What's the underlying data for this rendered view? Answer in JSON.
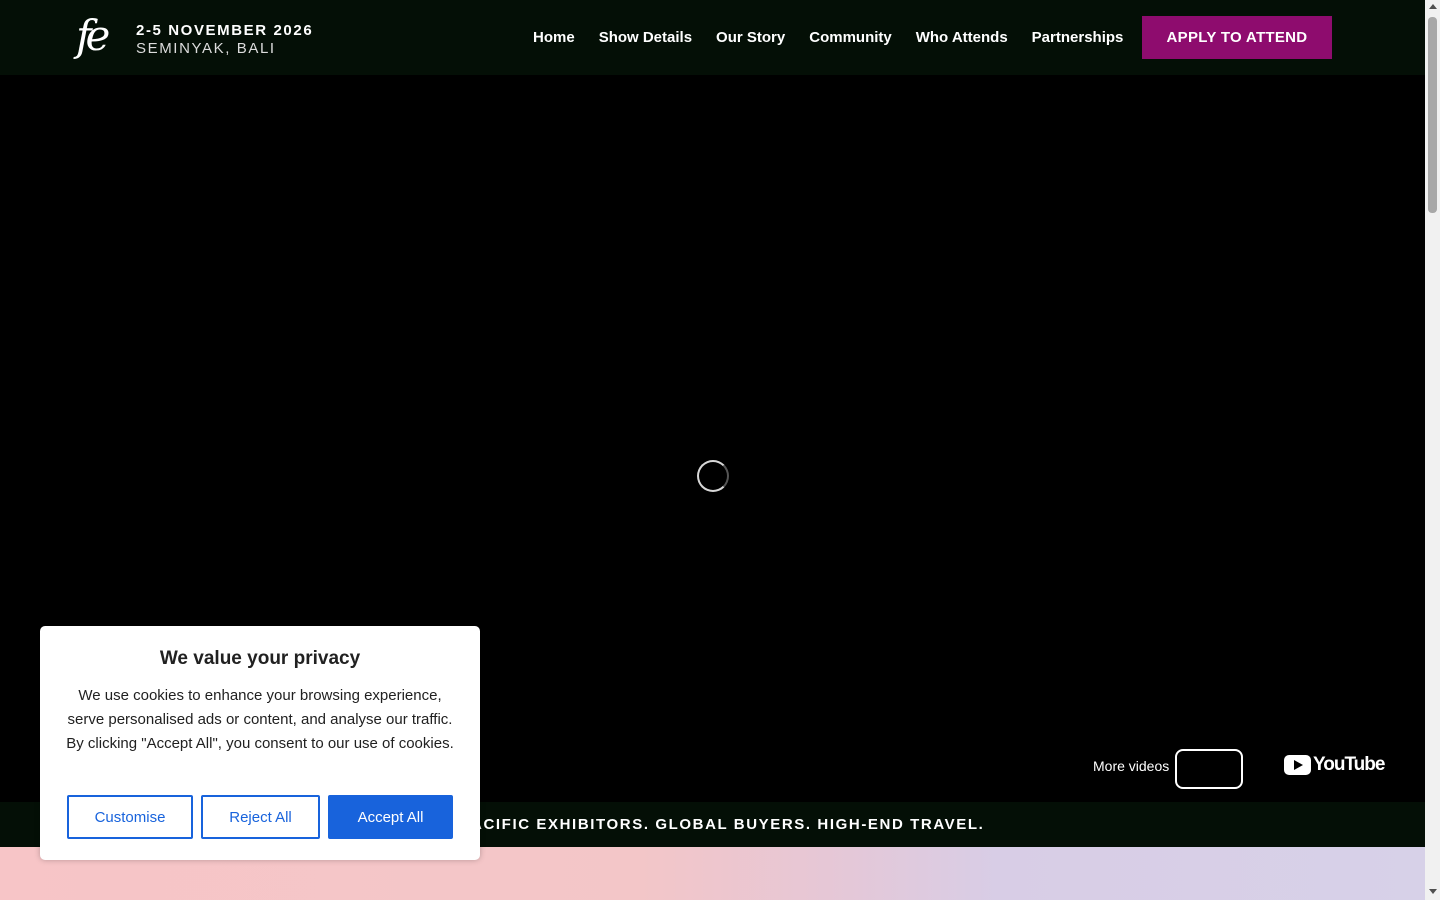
{
  "header": {
    "logo_text": "fe",
    "event_date": "2-5 NOVEMBER 2026",
    "event_location": "SEMINYAK, BALI",
    "nav": [
      {
        "label": "Home"
      },
      {
        "label": "Show Details"
      },
      {
        "label": "Our Story"
      },
      {
        "label": "Community"
      },
      {
        "label": "Who Attends"
      },
      {
        "label": "Partnerships"
      }
    ],
    "cta_label": "APPLY TO ATTEND",
    "cta_color": "#8e0c6e"
  },
  "video": {
    "more_videos_label": "More videos",
    "youtube_label": "YouTube"
  },
  "ticker": {
    "text": "PACIFIC EXHIBITORS. GLOBAL BUYERS. HIGH-END TRAVEL."
  },
  "cookie_banner": {
    "title": "We value your privacy",
    "body": "We use cookies to enhance your browsing experience, serve personalised ads or content, and analyse our traffic. By clicking \"Accept All\", you consent to our use of cookies.",
    "customise_label": "Customise",
    "reject_label": "Reject All",
    "accept_label": "Accept All",
    "accent_color": "#1863dc"
  }
}
